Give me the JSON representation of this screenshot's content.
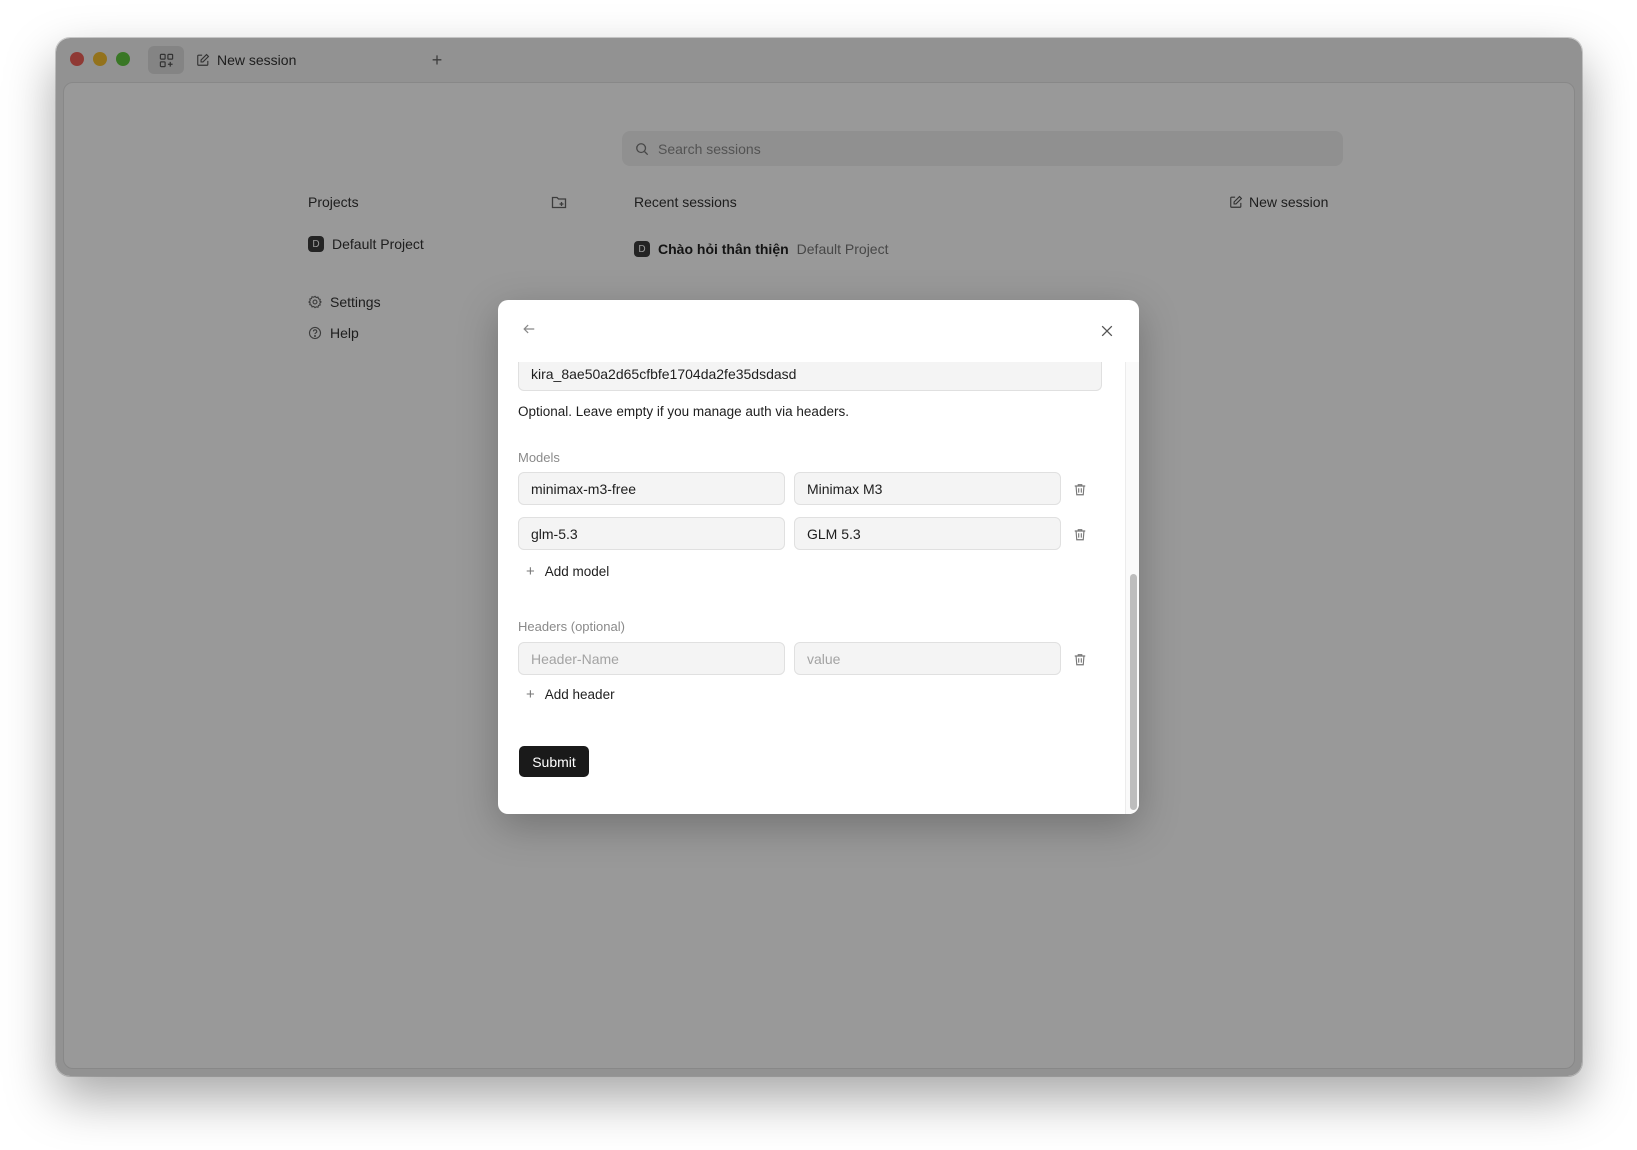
{
  "titlebar": {
    "tab_label": "New session",
    "new_tab_glyph": "+"
  },
  "search": {
    "placeholder": "Search sessions"
  },
  "sidebar": {
    "projects_title": "Projects",
    "project": {
      "badge": "D",
      "name": "Default Project"
    },
    "links": {
      "settings": "Settings",
      "help": "Help"
    }
  },
  "main": {
    "recent_title": "Recent sessions",
    "new_session_label": "New session",
    "sessions": [
      {
        "badge": "D",
        "title": "Chào hỏi thân thiện",
        "project": "Default Project"
      }
    ]
  },
  "modal": {
    "api_key_value": "kira_8ae50a2d65cfbfe1704da2fe35dsdasd",
    "api_key_hint": "Optional. Leave empty if you manage auth via headers.",
    "models_label": "Models",
    "models": [
      {
        "id": "minimax-m3-free",
        "name": "Minimax M3"
      },
      {
        "id": "glm-5.3",
        "name": "GLM 5.3"
      }
    ],
    "add_model_label": "Add model",
    "headers_label": "Headers (optional)",
    "header_name_placeholder": "Header-Name",
    "header_value_placeholder": "value",
    "add_header_label": "Add header",
    "submit_label": "Submit"
  },
  "colors": {
    "accent": "#1a1a1a",
    "close_red": "#ee5f57",
    "minimize_yellow": "#f6be30",
    "zoom_green": "#5fc73f",
    "overlay": "rgba(0,0,0,0.40)"
  },
  "icons": [
    "layout-grid-icon",
    "edit-icon",
    "plus-icon",
    "search-icon",
    "folder-plus-icon",
    "gear-icon",
    "help-icon",
    "arrow-left-icon",
    "close-icon",
    "trash-icon"
  ]
}
